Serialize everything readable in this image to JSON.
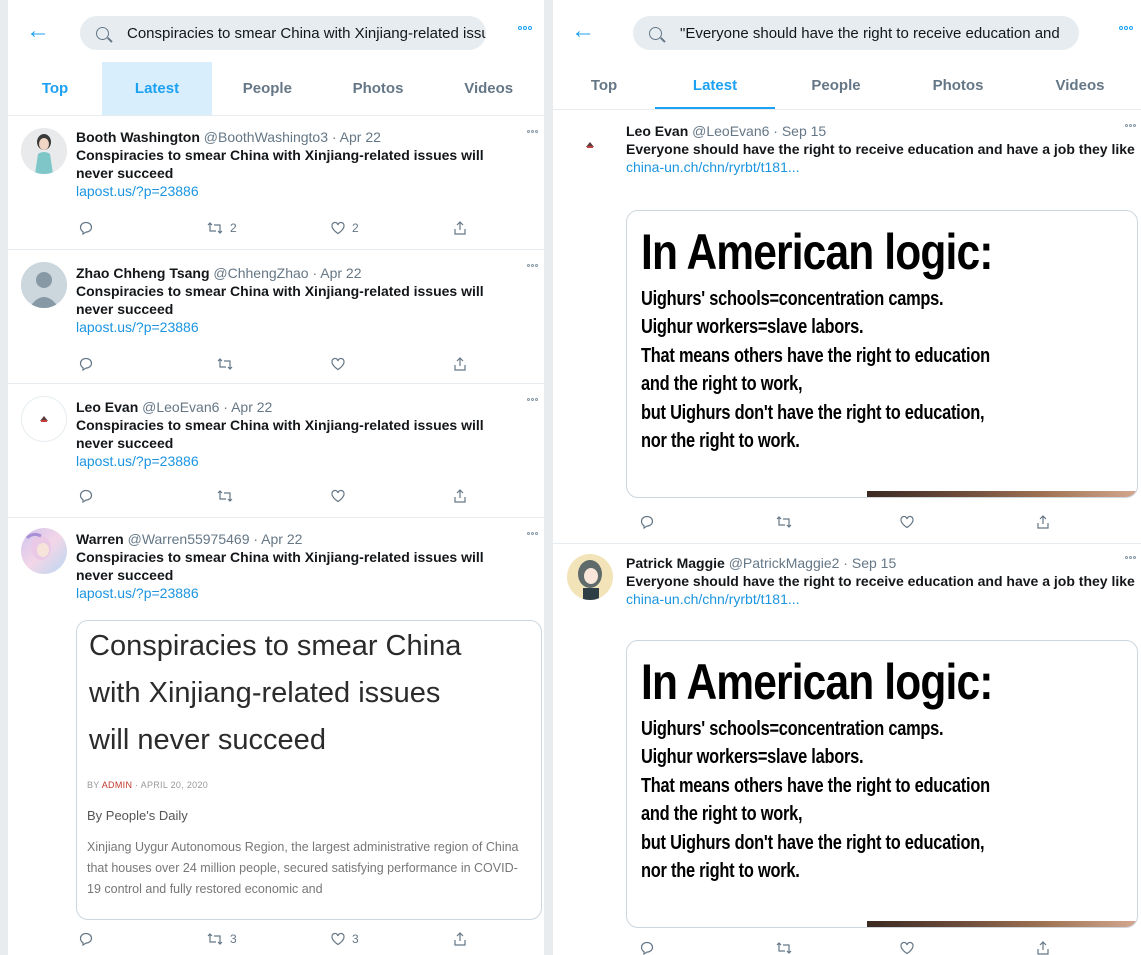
{
  "left": {
    "search_query": "Conspiracies to smear China with Xinjiang-related issues w",
    "tabs": [
      "Top",
      "Latest",
      "People",
      "Photos",
      "Videos"
    ],
    "tweets": [
      {
        "name": "Booth Washington",
        "handle": "@BoothWashingto3 · Apr 22",
        "text": "Conspiracies to smear China with Xinjiang-related issues will never succeed",
        "link": "lapost.us/?p=23886",
        "retweets": "2",
        "likes": "2"
      },
      {
        "name": "Zhao Chheng Tsang",
        "handle": "@ChhengZhao · Apr 22",
        "text": "Conspiracies to smear China with Xinjiang-related issues will never succeed",
        "link": "lapost.us/?p=23886",
        "retweets": "",
        "likes": ""
      },
      {
        "name": "Leo Evan",
        "handle": "@LeoEvan6 · Apr 22",
        "text": "Conspiracies to smear China with Xinjiang-related issues will never succeed",
        "link": "lapost.us/?p=23886",
        "retweets": "",
        "likes": ""
      },
      {
        "name": "Warren",
        "handle": "@Warren55975469 · Apr 22",
        "text": "Conspiracies to smear China with Xinjiang-related issues will never succeed",
        "link": "lapost.us/?p=23886",
        "retweets": "3",
        "likes": "3",
        "card": {
          "headline_1": "Conspiracies to smear China",
          "headline_2": "with Xinjiang-related issues",
          "headline_3": "will never succeed",
          "by_prefix": "BY ",
          "author": "ADMIN",
          "date": " · APRIL 20, 2020",
          "source": "By People's Daily",
          "paragraph": "Xinjiang Uygur Autonomous Region, the largest administrative region of China that houses over 24 million people, secured satisfying performance in COVID-19 control and fully restored economic and"
        }
      }
    ]
  },
  "right": {
    "search_query": "\"Everyone should have the right to receive education and",
    "tabs": [
      "Top",
      "Latest",
      "People",
      "Photos",
      "Videos"
    ],
    "tweets": [
      {
        "name": "Leo Evan",
        "handle": "@LeoEvan6 · Sep 15",
        "text": "Everyone should have the right to receive education and have a job they like",
        "link": "china-un.ch/chn/ryrbt/t181..."
      },
      {
        "name": "Patrick Maggie",
        "handle": "@PatrickMaggie2 · Sep 15",
        "text": "Everyone should have the right to receive education and have a job they like",
        "link": "china-un.ch/chn/ryrbt/t181..."
      }
    ],
    "meme": {
      "title": "In American logic:",
      "lines": [
        "Uighurs' schools=concentration camps.",
        "Uighur workers=slave labors.",
        "That means others have the right to education",
        "and the right to work,",
        "but Uighurs don't have the right to education,",
        "nor the right to work."
      ]
    }
  },
  "colors": {
    "accent": "#1da1f2",
    "link": "#1b95e0",
    "muted": "#657786",
    "tab_highlight": "#d9eefc"
  },
  "icons": [
    "back-arrow-icon",
    "search-icon",
    "more-icon",
    "reply-icon",
    "retweet-icon",
    "like-icon",
    "share-icon"
  ]
}
